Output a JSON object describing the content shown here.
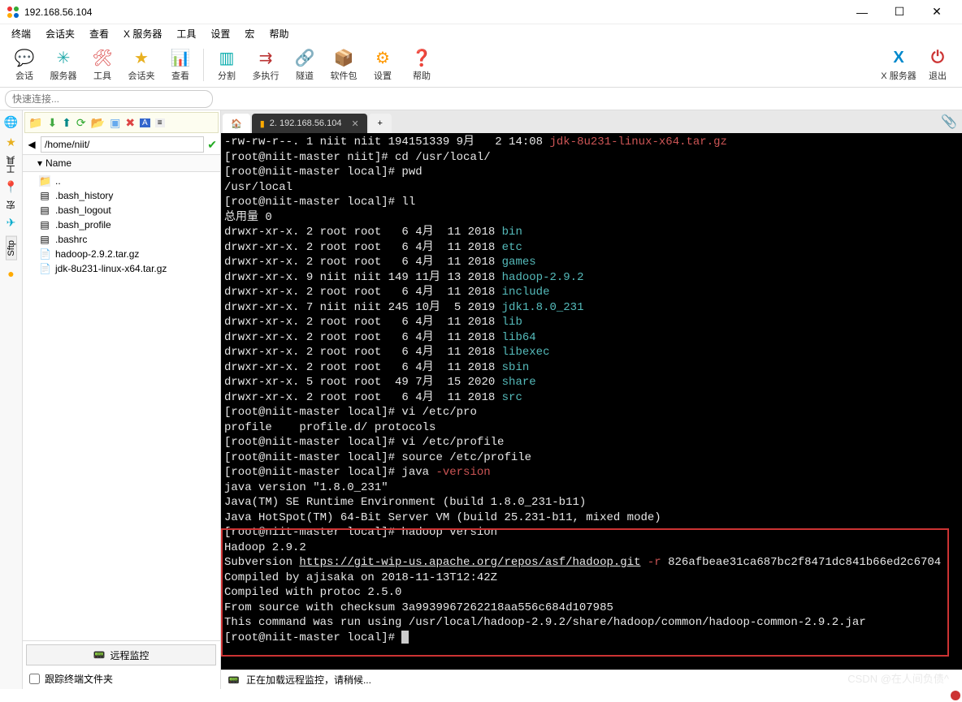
{
  "window": {
    "title": "192.168.56.104"
  },
  "menu": [
    "终端",
    "会话夹",
    "查看",
    "X 服务器",
    "工具",
    "设置",
    "宏",
    "帮助"
  ],
  "toolbar": [
    {
      "label": "会话",
      "icon": "💬",
      "color": "#2a7de1"
    },
    {
      "label": "服务器",
      "icon": "✳",
      "color": "#2aa"
    },
    {
      "label": "工具",
      "icon": "🛠",
      "color": "#d55"
    },
    {
      "label": "会话夹",
      "icon": "★",
      "color": "#e8b020"
    },
    {
      "label": "查看",
      "icon": "📊",
      "color": "#888"
    },
    {
      "sep": true
    },
    {
      "label": "分割",
      "icon": "▥",
      "color": "#0aa"
    },
    {
      "label": "多执行",
      "icon": "⇉",
      "color": "#b33"
    },
    {
      "label": "隧道",
      "icon": "🔗",
      "color": "#0a8"
    },
    {
      "label": "软件包",
      "icon": "📦",
      "color": "#36c"
    },
    {
      "label": "设置",
      "icon": "⚙",
      "color": "#f90"
    },
    {
      "label": "帮助",
      "icon": "❓",
      "color": "#08c"
    }
  ],
  "toolbar_right": [
    {
      "label": "X 服务器",
      "icon": "X",
      "color": "#08c"
    },
    {
      "label": "退出",
      "icon": "⏻",
      "color": "#c33"
    }
  ],
  "quick_placeholder": "快速连接...",
  "sidebar": {
    "path": "/home/niit/",
    "header": "Name",
    "updir": "..",
    "files": [
      {
        "name": ".bash_history",
        "icon": "▤"
      },
      {
        "name": ".bash_logout",
        "icon": "▤"
      },
      {
        "name": ".bash_profile",
        "icon": "▤"
      },
      {
        "name": ".bashrc",
        "icon": "▤"
      },
      {
        "name": "hadoop-2.9.2.tar.gz",
        "icon": "📄"
      },
      {
        "name": "jdk-8u231-linux-x64.tar.gz",
        "icon": "📄"
      }
    ],
    "remote_monitor": "远程监控",
    "follow_folder": "跟踪终端文件夹"
  },
  "tabs": {
    "home_icon": "🏠",
    "active": "2. 192.168.56.104",
    "plus": "+"
  },
  "leftbar_sftp": "Sftp",
  "statusbar": "正在加载远程监控，请稍候...",
  "watermark": "CSDN @在人间负债^",
  "term": {
    "l1a": "-rw-rw-r--. 1 niit niit 194151339 9月   2 14:08 ",
    "l1b": "jdk-8u231-linux-x64.tar.gz",
    "l2": "[root@niit-master niit]# cd /usr/local/",
    "l3": "[root@niit-master local]# pwd",
    "l4": "/usr/local",
    "l5": "[root@niit-master local]# ll",
    "l6": "总用量 0",
    "d1": "drwxr-xr-x. 2 root root   6 4月  11 2018 ",
    "d1n": "bin",
    "d2": "drwxr-xr-x. 2 root root   6 4月  11 2018 ",
    "d2n": "etc",
    "d3": "drwxr-xr-x. 2 root root   6 4月  11 2018 ",
    "d3n": "games",
    "d4": "drwxr-xr-x. 9 niit niit 149 11月 13 2018 ",
    "d4n": "hadoop-2.9.2",
    "d5": "drwxr-xr-x. 2 root root   6 4月  11 2018 ",
    "d5n": "include",
    "d6": "drwxr-xr-x. 7 niit niit 245 10月  5 2019 ",
    "d6n": "jdk1.8.0_231",
    "d7": "drwxr-xr-x. 2 root root   6 4月  11 2018 ",
    "d7n": "lib",
    "d8": "drwxr-xr-x. 2 root root   6 4月  11 2018 ",
    "d8n": "lib64",
    "d9": "drwxr-xr-x. 2 root root   6 4月  11 2018 ",
    "d9n": "libexec",
    "d10": "drwxr-xr-x. 2 root root   6 4月  11 2018 ",
    "d10n": "sbin",
    "d11": "drwxr-xr-x. 5 root root  49 7月  15 2020 ",
    "d11n": "share",
    "d12": "drwxr-xr-x. 2 root root   6 4月  11 2018 ",
    "d12n": "src",
    "l7": "[root@niit-master local]# vi /etc/pro",
    "l8": "profile    profile.d/ protocols",
    "l9": "[root@niit-master local]# vi /etc/profile",
    "l10": "[root@niit-master local]# source /etc/profile",
    "l11a": "[root@niit-master local]# java ",
    "l11b": "-version",
    "l12": "java version \"1.8.0_231\"",
    "l13": "Java(TM) SE Runtime Environment (build 1.8.0_231-b11)",
    "l14": "Java HotSpot(TM) 64-Bit Server VM (build 25.231-b11, mixed mode)",
    "h1": "[root@niit-master local]# hadoop version",
    "h2": "Hadoop 2.9.2",
    "h3a": "Subversion ",
    "h3b": "https://git-wip-us.apache.org/repos/asf/hadoop.git",
    "h3c": " -r",
    "h3d": " 826afbeae31ca687bc2f8471dc841b66ed2c6704",
    "h4": "Compiled by ajisaka on 2018-11-13T12:42Z",
    "h5": "Compiled with protoc 2.5.0",
    "h6": "From source with checksum 3a9939967262218aa556c684d107985",
    "h7": "This command was run using /usr/local/hadoop-2.9.2/share/hadoop/common/hadoop-common-2.9.2.jar",
    "p1": "[root@niit-master local]# "
  }
}
